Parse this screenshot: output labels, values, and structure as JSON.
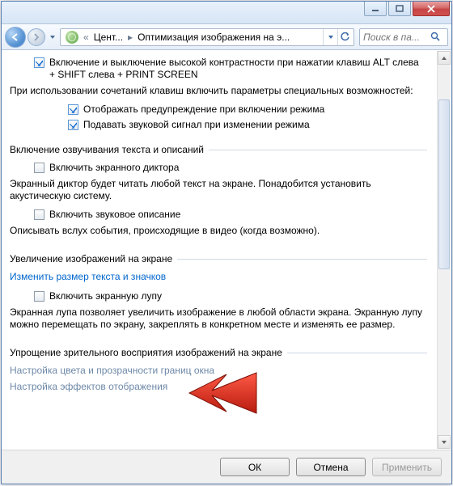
{
  "breadcrumb": {
    "seg1": "Цент...",
    "seg2": "Оптимизация изображения на э..."
  },
  "search": {
    "placeholder": "Поиск в па..."
  },
  "top": {
    "contrast_label": "Включение и выключение высокой контрастности при нажатии клавиш ALT слева + SHIFT слева + PRINT SCREEN",
    "contrast_desc": "При использовании сочетаний клавиш включить параметры специальных возможностей:",
    "warn_label": "Отображать предупреждение при включении режима",
    "sound_label": "Подавать звуковой сигнал при изменении режима"
  },
  "narration": {
    "title": "Включение озвучивания текста и описаний",
    "narrator_label": "Включить экранного диктора",
    "narrator_desc": "Экранный диктор будет читать любой текст на экране. Понадобится установить акустическую систему.",
    "audio_label": "Включить звуковое описание",
    "audio_desc": "Описывать вслух события, происходящие в видео (когда возможно)."
  },
  "magnify": {
    "title": "Увеличение изображений на экране",
    "resize_link": "Изменить размер текста и значков",
    "magnifier_label": "Включить экранную лупу",
    "magnifier_desc": "Экранная лупа позволяет увеличить изображение в любой области экрана. Экранную лупу можно перемещать по экрану, закреплять в конкретном месте и изменять ее размер."
  },
  "simplify": {
    "title": "Упрощение зрительного восприятия изображений на экране",
    "color_link": "Настройка цвета и прозрачности границ окна",
    "effects_link": "Настройка эффектов отображения"
  },
  "footer": {
    "ok": "ОК",
    "cancel": "Отмена",
    "apply": "Применить"
  }
}
